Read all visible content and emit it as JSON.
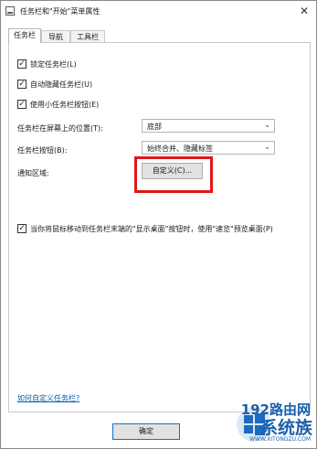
{
  "window": {
    "title": "任务栏和\"开始\"菜单属性",
    "close_glyph": "✕"
  },
  "tabs": [
    "任务栏",
    "导航",
    "工具栏"
  ],
  "checkboxes": [
    {
      "label": "锁定任务栏(L)",
      "checked": true
    },
    {
      "label": "自动隐藏任务栏(U)",
      "checked": true
    },
    {
      "label": "使用小任务栏按钮(E)",
      "checked": true
    }
  ],
  "position": {
    "label": "任务栏在屏幕上的位置(T):",
    "value": "底部"
  },
  "buttons_setting": {
    "label": "任务栏按钮(B):",
    "value": "始终合并、隐藏标签"
  },
  "notify": {
    "label": "通知区域:",
    "customize_label": "自定义(C)..."
  },
  "peek": {
    "label": "当你将鼠标移动到任务栏末端的\"显示桌面\"按钮时，使用\"速览\"预览桌面(P)",
    "checked": true
  },
  "link": {
    "text": "如何自定义任务栏?"
  },
  "footer": {
    "ok_label": "确定"
  },
  "watermark": {
    "line1": "192路由网",
    "line2": "系统族",
    "line3": "WWW.XITONGZU.COM"
  },
  "colors": {
    "highlight": "#e01818",
    "link": "#0a5fb0",
    "watermark": "#1b5faa"
  }
}
